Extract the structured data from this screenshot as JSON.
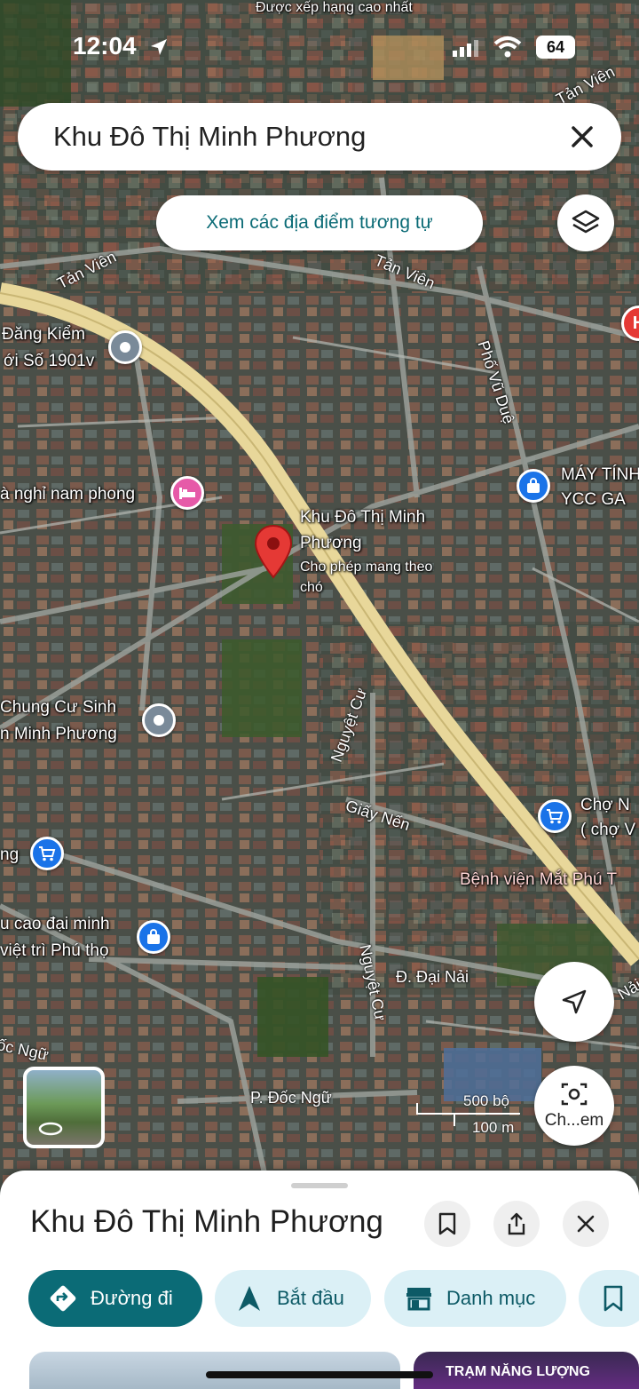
{
  "status_bar": {
    "time": "12:04",
    "battery": "64"
  },
  "map": {
    "top_label": "Được xếp hạng cao nhất",
    "streets": [
      {
        "id": "tan-vien-top-right",
        "text": "Tản Viên"
      },
      {
        "id": "tan-vien-left",
        "text": "Tản Viên"
      },
      {
        "id": "tan-vien-center",
        "text": "Tản Viên"
      },
      {
        "id": "pho-vu-due",
        "text": "Phố Vũ Duệ"
      },
      {
        "id": "nguyet-cu-1",
        "text": "Nguyệt Cư"
      },
      {
        "id": "giay-nen",
        "text": "Giấy Nến"
      },
      {
        "id": "nguyet-cu-2",
        "text": "Nguyệt Cư"
      },
      {
        "id": "dai-nai",
        "text": "Đ. Đại Nải"
      },
      {
        "id": "doc-ngu-left",
        "text": "ốc Ngữ"
      },
      {
        "id": "doc-ngu",
        "text": "P. Đốc Ngữ"
      },
      {
        "id": "nai-right",
        "text": "Nải"
      }
    ],
    "pois": {
      "dang_kiem_1": "Đăng Kiểm",
      "dang_kiem_2": "ới Số 1901v",
      "nha_nghi": "à nghỉ nam phong",
      "may_tinh_1": "MÁY TÍNH",
      "may_tinh_2": "YCC GA",
      "chung_cu_1": "Chung Cư Sinh",
      "chung_cu_2": "n Minh Phương",
      "cho_1": "Chợ N",
      "cho_2": "( chợ V",
      "ng": "ng",
      "benh_vien": "Bệnh viện Mắt Phú T",
      "cao_dai_1": "u cao đại minh",
      "cao_dai_2": "việt trì Phú thọ",
      "h_badge": "H"
    },
    "selected_pin": {
      "title_1": "Khu Đô Thị Minh",
      "title_2": "Phương",
      "note_1": "Cho phép mang theo",
      "note_2": "chó"
    },
    "scale": {
      "feet": "500 bộ",
      "meters": "100 m"
    },
    "similar_button": "Xem các địa điểm tương tự",
    "camera_label": "Ch...em"
  },
  "search": {
    "query": "Khu Đô Thị Minh Phương"
  },
  "sheet": {
    "title": "Khu Đô Thị Minh Phương",
    "chips": {
      "directions": "Đường đi",
      "start": "Bắt đầu",
      "category": "Danh mục"
    },
    "promo_text": "TRẠM NĂNG LƯỢNG"
  },
  "colors": {
    "accent": "#0b6b76",
    "chip_bg": "#dbf0f6",
    "pin_red": "#e53935",
    "highway": "#e8d79a"
  }
}
